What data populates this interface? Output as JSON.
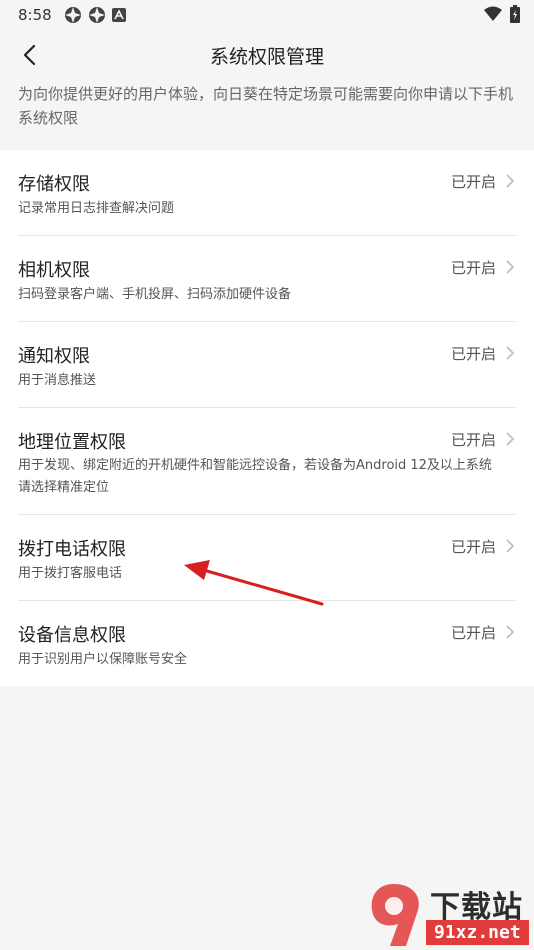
{
  "status_bar": {
    "time": "8:58"
  },
  "header": {
    "title": "系统权限管理"
  },
  "intro_text": "为向你提供更好的用户体验，向日葵在特定场景可能需要向你申请以下手机系统权限",
  "permissions": [
    {
      "title": "存储权限",
      "desc": "记录常用日志排查解决问题",
      "status": "已开启"
    },
    {
      "title": "相机权限",
      "desc": "扫码登录客户端、手机投屏、扫码添加硬件设备",
      "status": "已开启"
    },
    {
      "title": "通知权限",
      "desc": "用于消息推送",
      "status": "已开启"
    },
    {
      "title": "地理位置权限",
      "desc": "用于发现、绑定附近的开机硬件和智能远控设备，若设备为Android 12及以上系统请选择精准定位",
      "status": "已开启"
    },
    {
      "title": "拨打电话权限",
      "desc": "用于拨打客服电话",
      "status": "已开启"
    },
    {
      "title": "设备信息权限",
      "desc": "用于识别用户以保障账号安全",
      "status": "已开启"
    }
  ],
  "watermark": {
    "text": "下载站",
    "url_text": "91xz.net"
  }
}
